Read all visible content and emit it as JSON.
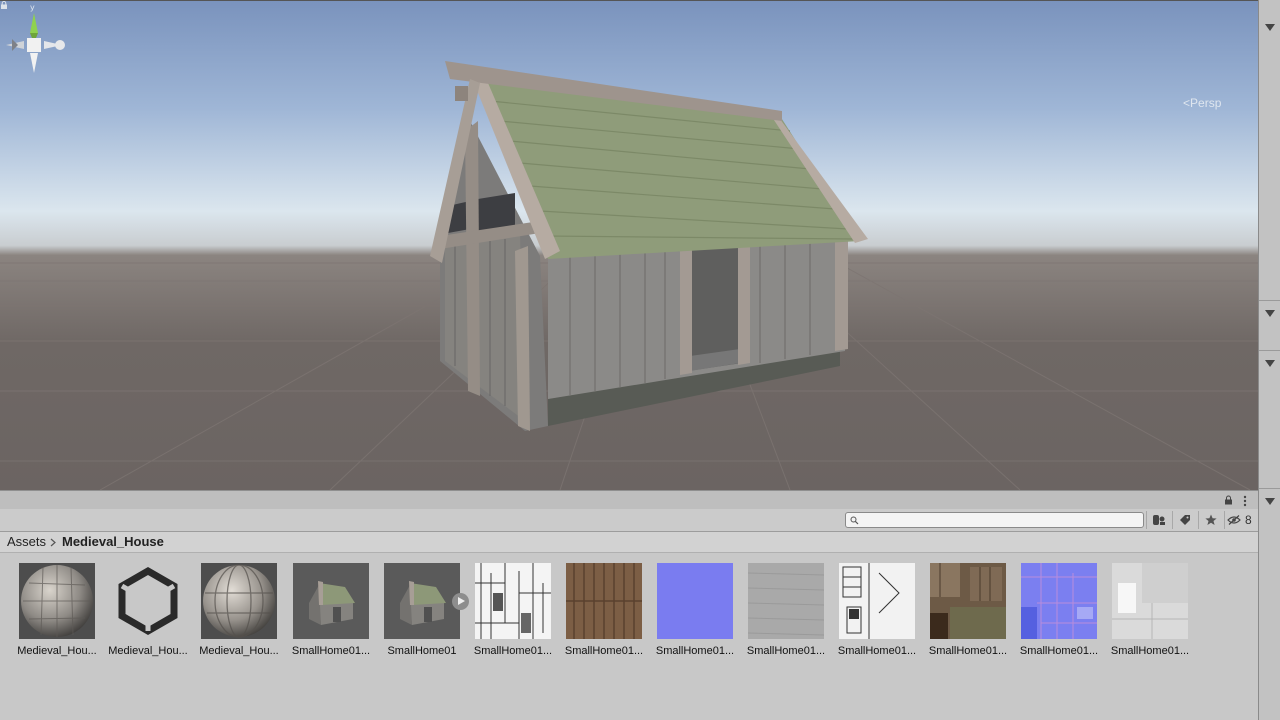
{
  "scene": {
    "view_mode_label": "Persp",
    "gizmo_axis_label": "y"
  },
  "project": {
    "breadcrumb_root": "Assets",
    "breadcrumb_current": "Medieval_House",
    "search_placeholder": "",
    "hidden_count": "8",
    "assets": [
      {
        "label": "Medieval_Hou...",
        "kind": "material-sphere-planks"
      },
      {
        "label": "Medieval_Hou...",
        "kind": "unity-logo"
      },
      {
        "label": "Medieval_Hou...",
        "kind": "material-sphere-beams"
      },
      {
        "label": "SmallHome01...",
        "kind": "model-house"
      },
      {
        "label": "SmallHome01",
        "kind": "prefab-house"
      },
      {
        "label": "SmallHome01...",
        "kind": "texture-white-detail"
      },
      {
        "label": "SmallHome01...",
        "kind": "texture-wood-planks"
      },
      {
        "label": "SmallHome01...",
        "kind": "texture-normal-flat"
      },
      {
        "label": "SmallHome01...",
        "kind": "texture-grey-noise"
      },
      {
        "label": "SmallHome01...",
        "kind": "texture-white-frames"
      },
      {
        "label": "SmallHome01...",
        "kind": "texture-color-atlas"
      },
      {
        "label": "SmallHome01...",
        "kind": "texture-normal-atlas"
      },
      {
        "label": "SmallHome01...",
        "kind": "texture-light-atlas"
      }
    ]
  },
  "colors": {
    "sky_top": "#7a93bd",
    "ground": "#6f6865",
    "normal_map": "#7a7cf0"
  }
}
